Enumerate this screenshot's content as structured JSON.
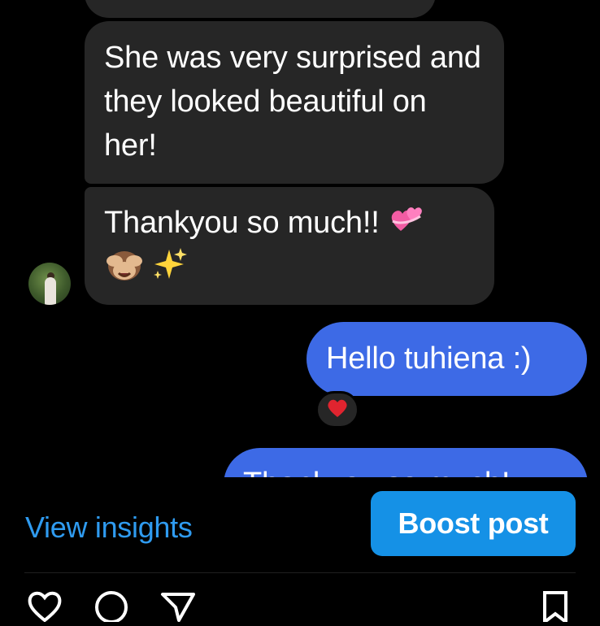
{
  "messages": [
    {
      "id": "m1",
      "sender": "them",
      "text": ""
    },
    {
      "id": "m2",
      "sender": "them",
      "text": "She was very surprised and they looked beautiful on her!"
    },
    {
      "id": "m3",
      "sender": "them",
      "text": "Thankyou so much!!",
      "emoji_line": "sparkles"
    },
    {
      "id": "m4",
      "sender": "me",
      "text": "Hello tuhiena :)",
      "reaction": "heart-icon"
    },
    {
      "id": "m5",
      "sender": "me",
      "text": "Thankyou so much!"
    }
  ],
  "footer": {
    "view_insights": "View insights",
    "boost_post": "Boost post"
  },
  "actions": [
    "like-icon",
    "comment-icon",
    "share-icon",
    "save-icon"
  ],
  "colors": {
    "incoming_bubble": "#262626",
    "outgoing_bubble": "#3d6ae6",
    "link": "#2f9bf0",
    "boost_button": "#1591e6",
    "heart": "#e0242f"
  }
}
